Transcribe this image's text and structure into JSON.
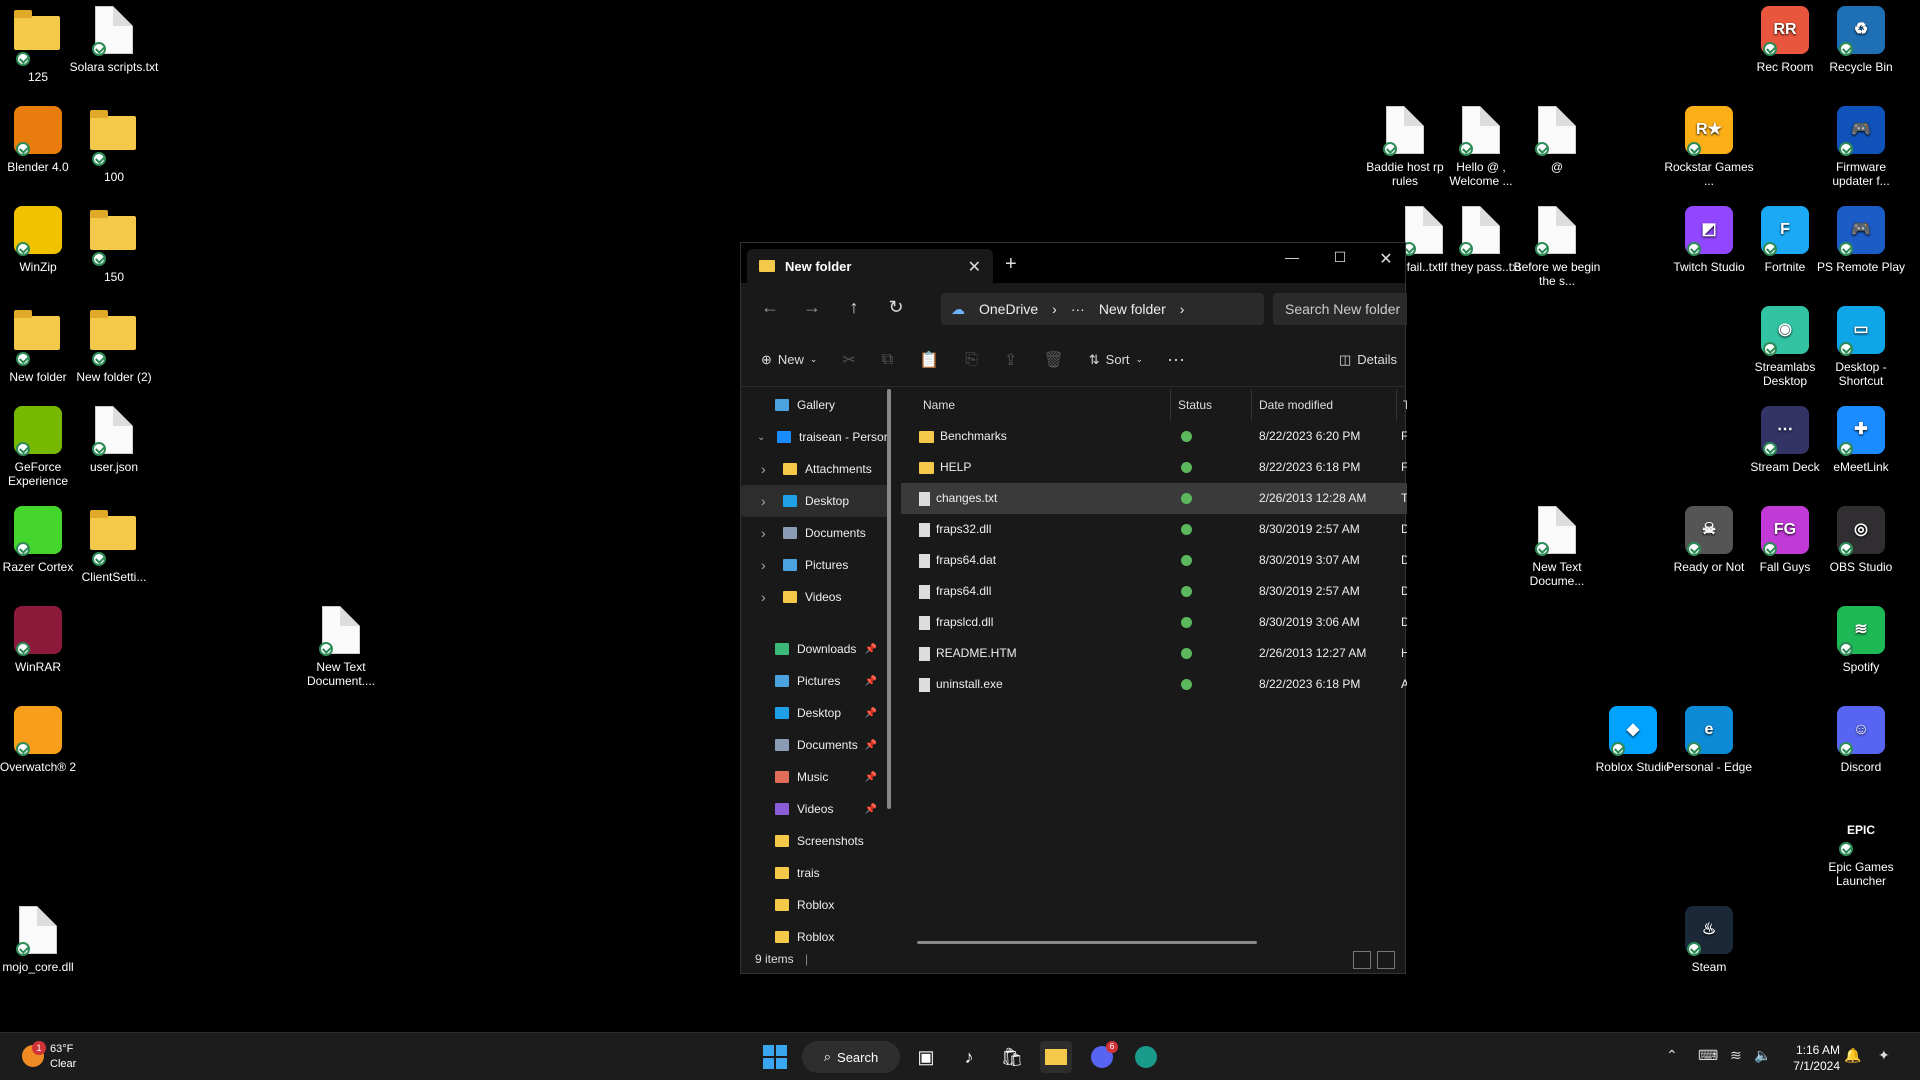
{
  "desktop_left": [
    {
      "label": "125",
      "type": "folder"
    },
    {
      "label": "Solara scripts.txt",
      "type": "doc"
    },
    {
      "label": "Blender 4.0",
      "type": "app",
      "color": "#e87d0d"
    },
    {
      "label": "100",
      "type": "folder"
    },
    {
      "label": "WinZip",
      "type": "app",
      "color": "#f2c200"
    },
    {
      "label": "150",
      "type": "folder"
    },
    {
      "label": "New folder",
      "type": "folder"
    },
    {
      "label": "New folder (2)",
      "type": "folder"
    },
    {
      "label": "GeForce Experience",
      "type": "app",
      "color": "#76b900"
    },
    {
      "label": "user.json",
      "type": "doc"
    },
    {
      "label": "Razer Cortex",
      "type": "app",
      "color": "#44d62c"
    },
    {
      "label": "ClientSetti...",
      "type": "folder"
    },
    {
      "label": "WinRAR",
      "type": "app",
      "color": "#8b1a3b"
    },
    {
      "label": "Overwatch® 2",
      "type": "app",
      "color": "#f99e1a"
    },
    {
      "label": "mojo_core.dll",
      "type": "doc"
    }
  ],
  "desktop_mid": [
    {
      "label": "New Text Document...."
    },
    {
      "label": "Baddie host rp rules"
    },
    {
      "label": "Hello @ , Welcome ..."
    },
    {
      "label": "@"
    },
    {
      "label": "fail..txt"
    },
    {
      "label": "If they pass..txt"
    },
    {
      "label": "Before we begin the s..."
    },
    {
      "label": "New Text Docume..."
    }
  ],
  "desktop_right": [
    {
      "label": "Rec Room",
      "color": "#e8573d",
      "glyph": "RR"
    },
    {
      "label": "Recycle Bin",
      "color": "#1f6fb5",
      "glyph": "♻"
    },
    {
      "label": "Rockstar Games ...",
      "color": "#fcaf17",
      "glyph": "R★"
    },
    {
      "label": "Firmware updater f...",
      "color": "#0f52ba",
      "glyph": "🎮"
    },
    {
      "label": "Twitch Studio",
      "color": "#9146ff",
      "glyph": "◩"
    },
    {
      "label": "Fortnite",
      "color": "#1ba9f5",
      "glyph": "F"
    },
    {
      "label": "PS Remote Play",
      "color": "#1c5cc7",
      "glyph": "🎮"
    },
    {
      "label": "Streamlabs Desktop",
      "color": "#31c3a2",
      "glyph": "◉"
    },
    {
      "label": "Desktop - Shortcut",
      "color": "#0ea5e9",
      "glyph": "▭"
    },
    {
      "label": "Stream Deck",
      "color": "#333366",
      "glyph": "⋯"
    },
    {
      "label": "eMeetLink",
      "color": "#1a8cff",
      "glyph": "✚"
    },
    {
      "label": "Ready or Not",
      "color": "#555555",
      "glyph": "☠"
    },
    {
      "label": "Fall Guys",
      "color": "#c13ad8",
      "glyph": "FG"
    },
    {
      "label": "OBS Studio",
      "color": "#302e31",
      "glyph": "◎"
    },
    {
      "label": "Spotify",
      "color": "#1db954",
      "glyph": "≋"
    },
    {
      "label": "Roblox Studio",
      "color": "#00a2ff",
      "glyph": "◆"
    },
    {
      "label": "Personal - Edge",
      "color": "#0c8ad6",
      "glyph": "e"
    },
    {
      "label": "Discord",
      "color": "#5865f2",
      "glyph": "☺"
    },
    {
      "label": "Epic Games Launcher",
      "color": "#000000",
      "glyph": "EPIC"
    },
    {
      "label": "Steam",
      "color": "#1b2838",
      "glyph": "♨"
    }
  ],
  "explorer": {
    "tab_title": "New folder",
    "address": {
      "root": "OneDrive",
      "more": "···",
      "current": "New folder"
    },
    "search_placeholder": "Search New folder",
    "toolbar": {
      "new": "New",
      "sort": "Sort",
      "more": "···",
      "details": "Details"
    },
    "sidebar": [
      {
        "label": "Gallery",
        "color": "#4aa3df",
        "indent": 1
      },
      {
        "label": "traisean - Persor",
        "color": "#1a8cff",
        "indent": 0,
        "expanded": true
      },
      {
        "label": "Attachments",
        "color": "#f4c94a",
        "indent": 2
      },
      {
        "label": "Desktop",
        "color": "#1fa0e6",
        "indent": 2,
        "selected": true
      },
      {
        "label": "Documents",
        "color": "#8a9bb5",
        "indent": 2
      },
      {
        "label": "Pictures",
        "color": "#4aa3df",
        "indent": 2
      },
      {
        "label": "Videos",
        "color": "#f4c94a",
        "indent": 2
      },
      {
        "label": "Downloads",
        "color": "#3cb878",
        "indent": 1,
        "pinned": true,
        "gap": true
      },
      {
        "label": "Pictures",
        "color": "#4aa3df",
        "indent": 1,
        "pinned": true
      },
      {
        "label": "Desktop",
        "color": "#1fa0e6",
        "indent": 1,
        "pinned": true
      },
      {
        "label": "Documents",
        "color": "#8a9bb5",
        "indent": 1,
        "pinned": true
      },
      {
        "label": "Music",
        "color": "#e06c5a",
        "indent": 1,
        "pinned": true
      },
      {
        "label": "Videos",
        "color": "#8a5cd6",
        "indent": 1,
        "pinned": true
      },
      {
        "label": "Screenshots",
        "color": "#f4c94a",
        "indent": 1
      },
      {
        "label": "trais",
        "color": "#f4c94a",
        "indent": 1
      },
      {
        "label": "Roblox",
        "color": "#f4c94a",
        "indent": 1
      },
      {
        "label": "Roblox",
        "color": "#f4c94a",
        "indent": 1
      }
    ],
    "columns": {
      "name": "Name",
      "status": "Status",
      "date": "Date modified",
      "type": "T"
    },
    "files": [
      {
        "name": "Benchmarks",
        "kind": "folder",
        "date": "8/22/2023 6:20 PM",
        "type": "F"
      },
      {
        "name": "HELP",
        "kind": "folder",
        "date": "8/22/2023 6:18 PM",
        "type": "F"
      },
      {
        "name": "changes.txt",
        "kind": "doc",
        "date": "2/26/2013 12:28 AM",
        "type": "T",
        "selected": true
      },
      {
        "name": "fraps32.dll",
        "kind": "doc",
        "date": "8/30/2019 2:57 AM",
        "type": "D"
      },
      {
        "name": "fraps64.dat",
        "kind": "doc",
        "date": "8/30/2019 3:07 AM",
        "type": "D"
      },
      {
        "name": "fraps64.dll",
        "kind": "doc",
        "date": "8/30/2019 2:57 AM",
        "type": "D"
      },
      {
        "name": "frapslcd.dll",
        "kind": "doc",
        "date": "8/30/2019 3:06 AM",
        "type": "D"
      },
      {
        "name": "README.HTM",
        "kind": "doc",
        "date": "2/26/2013 12:27 AM",
        "type": "H"
      },
      {
        "name": "uninstall.exe",
        "kind": "exe",
        "date": "8/22/2023 6:18 PM",
        "type": "A"
      }
    ],
    "status": "9 items"
  },
  "taskbar": {
    "weather_temp": "63°F",
    "weather_desc": "Clear",
    "weather_badge": "1",
    "search": "Search",
    "discord_badge": "6",
    "time": "1:16 AM",
    "date": "7/1/2024"
  }
}
